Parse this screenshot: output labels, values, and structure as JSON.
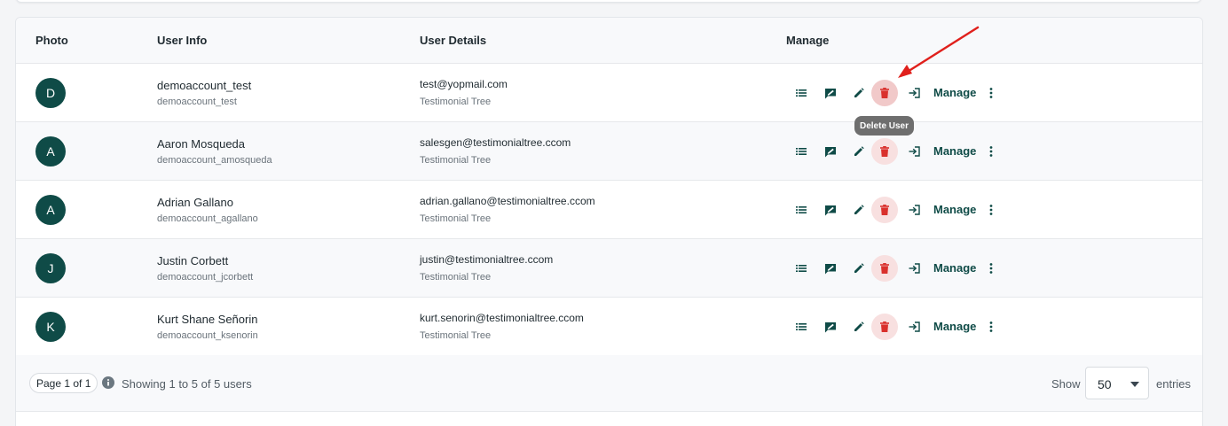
{
  "table": {
    "headers": {
      "photo": "Photo",
      "user_info": "User Info",
      "user_details": "User Details",
      "manage": "Manage"
    },
    "rows": [
      {
        "initial": "D",
        "name": "demoaccount_test",
        "username": "demoaccount_test",
        "email": "test@yopmail.com",
        "company": "Testimonial Tree",
        "manage_label": "Manage"
      },
      {
        "initial": "A",
        "name": "Aaron Mosqueda",
        "username": "demoaccount_amosqueda",
        "email": "salesgen@testimonialtree.ccom",
        "company": "Testimonial Tree",
        "manage_label": "Manage"
      },
      {
        "initial": "A",
        "name": "Adrian Gallano",
        "username": "demoaccount_agallano",
        "email": "adrian.gallano@testimonialtree.ccom",
        "company": "Testimonial Tree",
        "manage_label": "Manage"
      },
      {
        "initial": "J",
        "name": "Justin Corbett",
        "username": "demoaccount_jcorbett",
        "email": "justin@testimonialtree.ccom",
        "company": "Testimonial Tree",
        "manage_label": "Manage"
      },
      {
        "initial": "K",
        "name": "Kurt Shane Señorin",
        "username": "demoaccount_ksenorin",
        "email": "kurt.senorin@testimonialtree.ccom",
        "company": "Testimonial Tree",
        "manage_label": "Manage"
      }
    ],
    "action_icons": [
      "list-icon",
      "message-icon",
      "pencil-icon",
      "trash-icon",
      "login-icon",
      "kebab-menu-icon"
    ]
  },
  "tooltip": {
    "text": "Delete User"
  },
  "footer": {
    "page_badge": "Page 1 of 1",
    "showing_text": "Showing 1 to 5 of 5 users",
    "show_label": "Show",
    "entries_value": "50",
    "entries_label": "entries"
  },
  "colors": {
    "brand": "#0f4b47",
    "delete": "#d9302c",
    "delete_bg": "#f8e0e0",
    "annotation": "#e0201c"
  }
}
